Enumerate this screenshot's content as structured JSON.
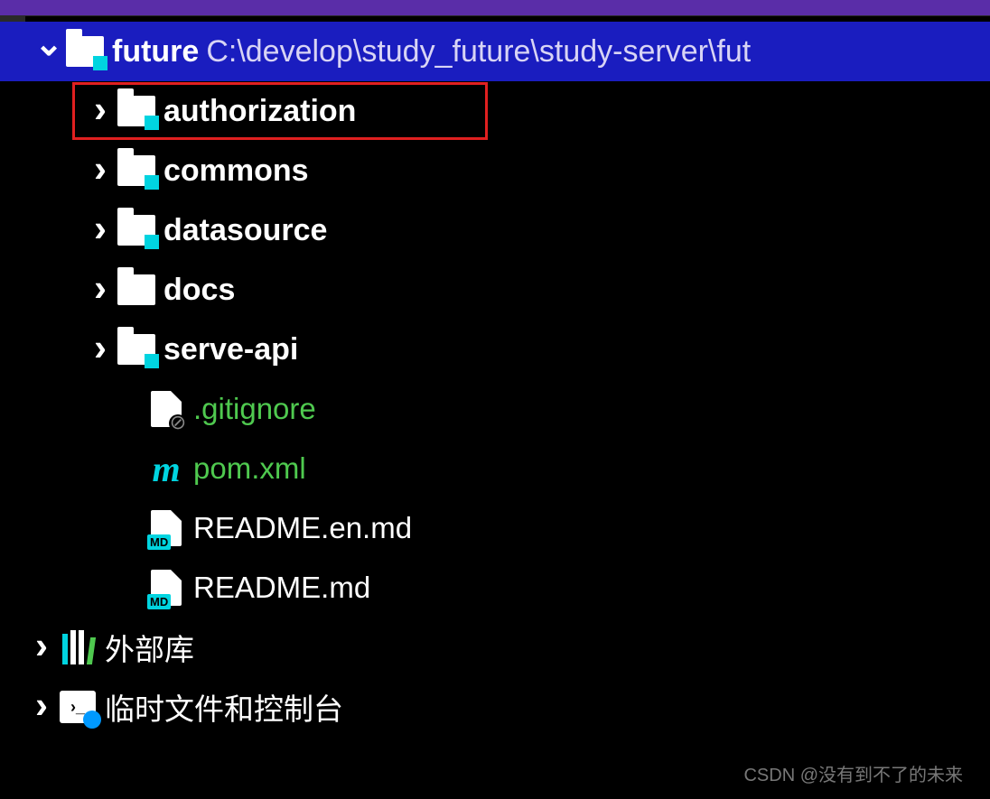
{
  "root": {
    "name": "future",
    "path": "C:\\develop\\study_future\\study-server\\fut"
  },
  "children": [
    {
      "name": "authorization",
      "type": "module",
      "highlighted": true
    },
    {
      "name": "commons",
      "type": "module"
    },
    {
      "name": "datasource",
      "type": "module"
    },
    {
      "name": "docs",
      "type": "folder"
    },
    {
      "name": "serve-api",
      "type": "module"
    }
  ],
  "files": [
    {
      "name": ".gitignore",
      "icon": "gitignore",
      "color": "green"
    },
    {
      "name": "pom.xml",
      "icon": "maven",
      "color": "green"
    },
    {
      "name": "README.en.md",
      "icon": "md",
      "color": "white"
    },
    {
      "name": "README.md",
      "icon": "md",
      "color": "white"
    }
  ],
  "extras": [
    {
      "name": "外部库",
      "icon": "lib"
    },
    {
      "name": "临时文件和控制台",
      "icon": "scratch"
    }
  ],
  "watermark": "CSDN @没有到不了的未来"
}
